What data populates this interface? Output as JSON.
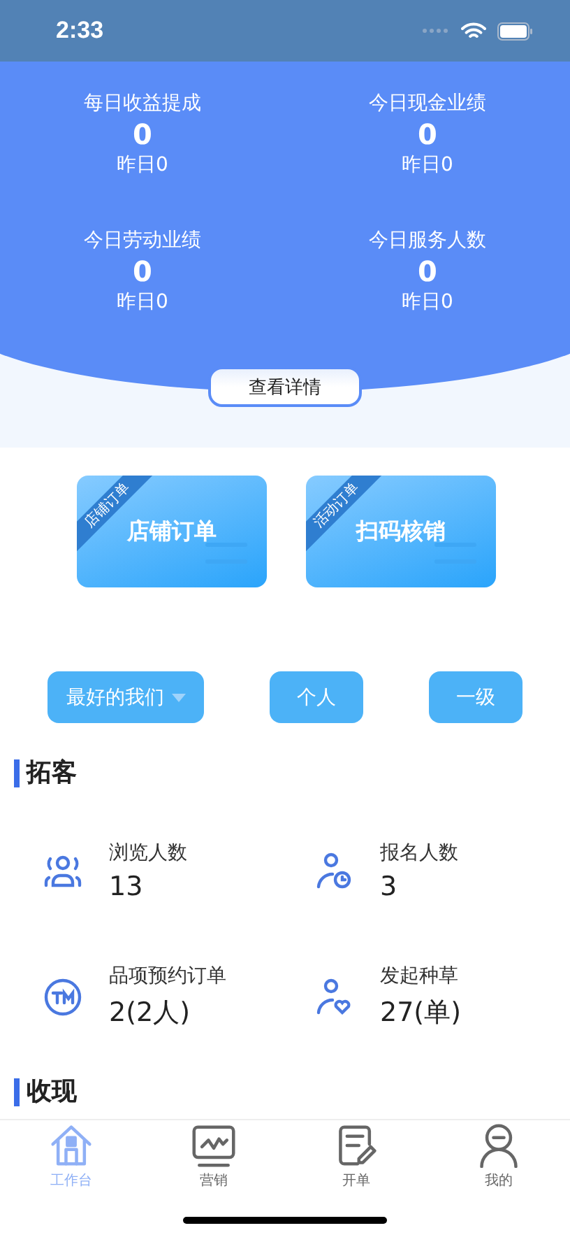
{
  "status_bar": {
    "time": "2:33"
  },
  "summary": [
    {
      "label": "每日收益提成",
      "value": "0",
      "yesterday": "昨日0"
    },
    {
      "label": "今日现金业绩",
      "value": "0",
      "yesterday": "昨日0"
    },
    {
      "label": "今日劳动业绩",
      "value": "0",
      "yesterday": "昨日0"
    },
    {
      "label": "今日服务人数",
      "value": "0",
      "yesterday": "昨日0"
    }
  ],
  "details_button": "查看详情",
  "cards": [
    {
      "ribbon": "店铺订单",
      "title": "店铺订单"
    },
    {
      "ribbon": "活动订单",
      "title": "扫码核销"
    }
  ],
  "filters": [
    {
      "label": "最好的我们",
      "kind": "dropdown"
    },
    {
      "label": "个人",
      "kind": "plain"
    },
    {
      "label": "一级",
      "kind": "plain"
    }
  ],
  "sections": [
    {
      "title": "拓客",
      "metrics": [
        {
          "label": "浏览人数",
          "value": "13",
          "kind": "viewers"
        },
        {
          "label": "报名人数",
          "value": "3",
          "kind": "signup"
        },
        {
          "label": "品项预约订单",
          "value": "2(2人)",
          "kind": "tm"
        },
        {
          "label": "发起种草",
          "value": "27(单)",
          "kind": "heart"
        }
      ]
    },
    {
      "title": "收现"
    }
  ],
  "tabs": [
    {
      "label": "工作台",
      "kind": "home",
      "selected": true
    },
    {
      "label": "营销",
      "kind": "chart",
      "selected": false
    },
    {
      "label": "开单",
      "kind": "note",
      "selected": false
    },
    {
      "label": "我的",
      "kind": "person",
      "selected": false
    }
  ]
}
